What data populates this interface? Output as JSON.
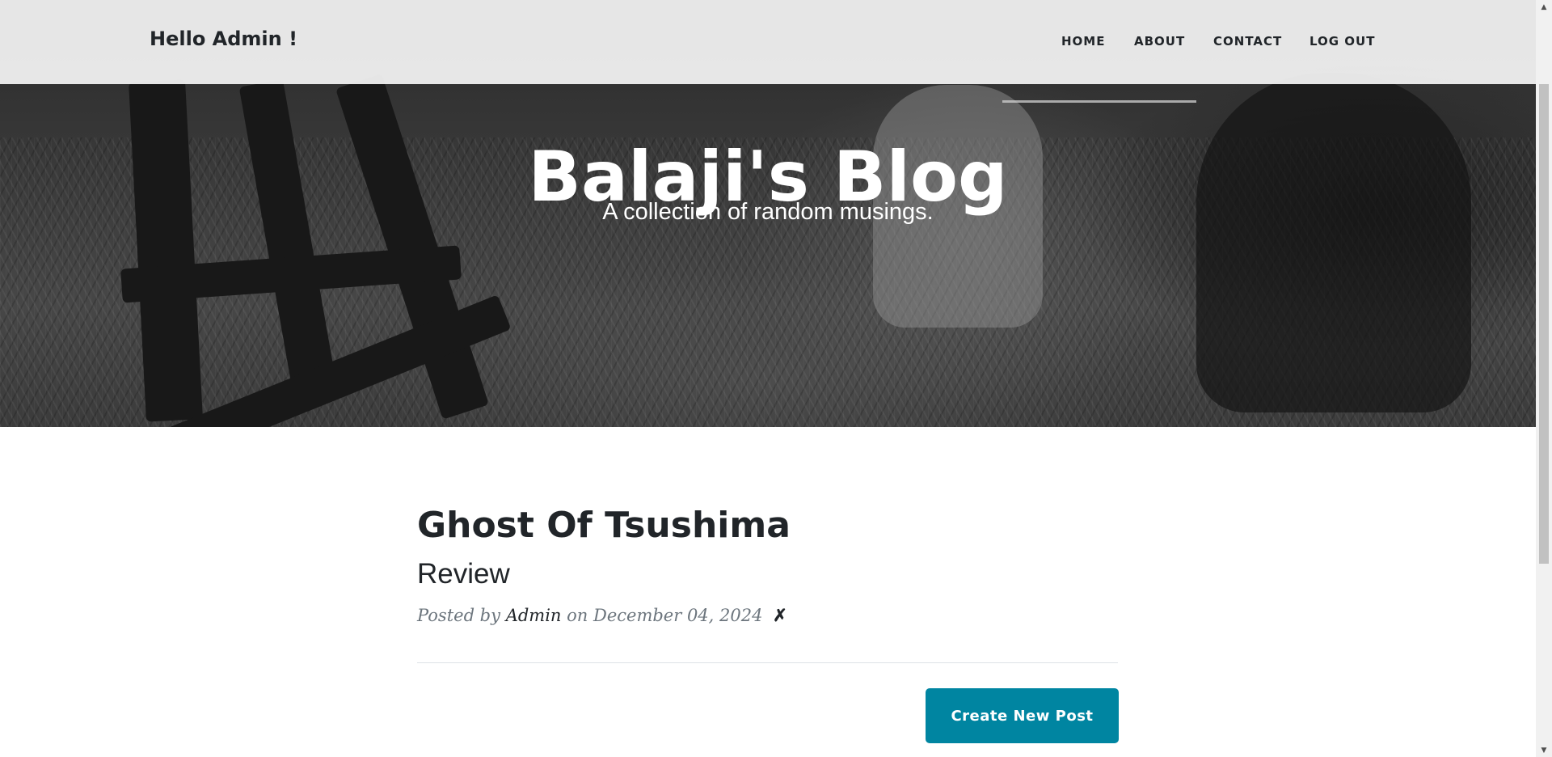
{
  "navbar": {
    "brand": "Hello Admin !",
    "links": [
      {
        "label": "HOME"
      },
      {
        "label": "ABOUT"
      },
      {
        "label": "CONTACT"
      },
      {
        "label": "LOG OUT"
      }
    ]
  },
  "hero": {
    "title": "Balaji's Blog",
    "subtitle": "A collection of random musings."
  },
  "post": {
    "title": "Ghost Of Tsushima",
    "subtitle": "Review",
    "meta_prefix": "Posted by",
    "author": "Admin",
    "meta_on": "on",
    "date": "December 04, 2024",
    "delete_symbol": "✗"
  },
  "actions": {
    "create_label": "Create New Post"
  },
  "colors": {
    "accent": "#0085a1",
    "text": "#212529",
    "muted": "#6c757d"
  },
  "icons": {
    "scroll_up": "triangle-up-icon",
    "scroll_down": "triangle-down-icon"
  }
}
